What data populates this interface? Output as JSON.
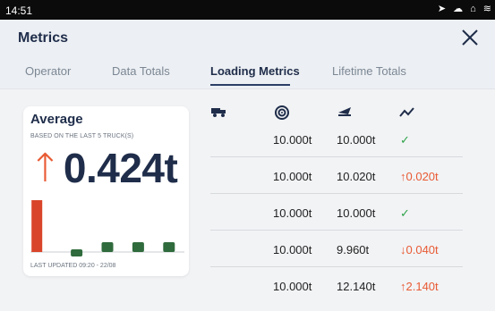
{
  "status_bar": {
    "time": "14:51",
    "icons": [
      "location-icon",
      "cloud-icon",
      "home-icon",
      "wifi-icon"
    ]
  },
  "header": {
    "title": "Metrics",
    "close_icon": "close-icon"
  },
  "tabs": [
    {
      "label": "Operator",
      "active": false
    },
    {
      "label": "Data Totals",
      "active": false
    },
    {
      "label": "Loading Metrics",
      "active": true
    },
    {
      "label": "Lifetime Totals",
      "active": false
    }
  ],
  "average_card": {
    "title": "Average",
    "subtitle": "BASED ON THE LAST 5 TRUCK(S)",
    "trend": "up",
    "value": "0.424t",
    "last_updated": "LAST UPDATED 09:20 - 22/08",
    "bars": [
      {
        "value": 0.424,
        "color": "#d9452a"
      },
      {
        "value": -0.02,
        "color": "#2f6b3c"
      },
      {
        "value": 0.02,
        "color": "#2f6b3c"
      },
      {
        "value": 0.04,
        "color": "#2f6b3c"
      },
      {
        "value": 0.02,
        "color": "#2f6b3c"
      }
    ]
  },
  "columns": [
    "truck-icon",
    "target-icon",
    "scale-icon",
    "trend-icon"
  ],
  "rows": [
    {
      "target": "10.000t",
      "actual": "10.000t",
      "delta": "✓",
      "delta_type": "ok"
    },
    {
      "target": "10.000t",
      "actual": "10.020t",
      "delta": "↑0.020t",
      "delta_type": "up"
    },
    {
      "target": "10.000t",
      "actual": "10.000t",
      "delta": "✓",
      "delta_type": "ok"
    },
    {
      "target": "10.000t",
      "actual": "9.960t",
      "delta": "↓0.040t",
      "delta_type": "down"
    },
    {
      "target": "10.000t",
      "actual": "12.140t",
      "delta": "↑2.140t",
      "delta_type": "up"
    }
  ],
  "colors": {
    "accent_dark": "#1f2d4a",
    "up_arrow": "#e85b34",
    "ok_check": "#2fa34a",
    "bar_red": "#d9452a",
    "bar_green": "#2f6b3c"
  }
}
